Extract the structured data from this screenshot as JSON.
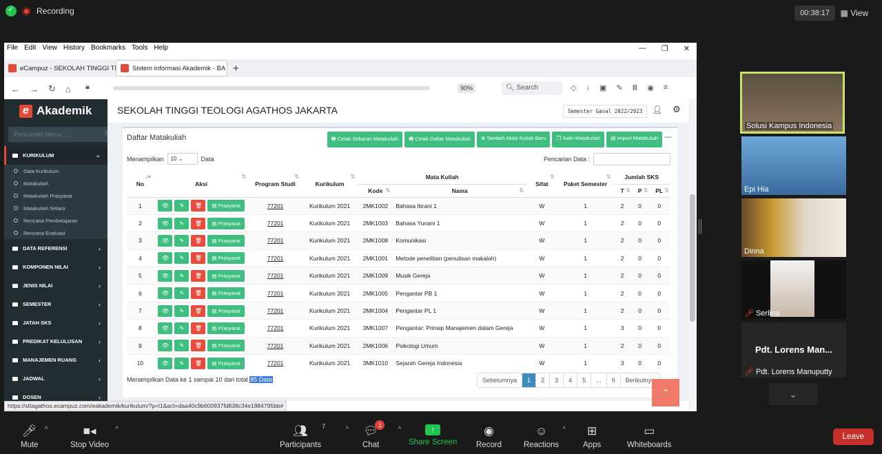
{
  "zoom": {
    "recording": "Recording",
    "clock": "00:38:17",
    "view": "View",
    "toolbar": {
      "mute": "Mute",
      "stop_video": "Stop Video",
      "participants": "Participants",
      "participants_count": "7",
      "chat": "Chat",
      "chat_badge": "1",
      "share": "Share Screen",
      "record": "Record",
      "reactions": "Reactions",
      "apps": "Apps",
      "whiteboards": "Whiteboards",
      "leave": "Leave"
    },
    "tiles": [
      "Solusi Kampus Indonesia",
      "Epi Hia",
      "Dinna",
      "Serlina",
      "Pdt. Lorens Manuputty"
    ],
    "tile5_name": "Pdt. Lorens Man..."
  },
  "browser": {
    "menu": [
      "File",
      "Edit",
      "View",
      "History",
      "Bookmarks",
      "Tools",
      "Help"
    ],
    "tabs": [
      "eCampuz - SEKOLAH TINGGI TE",
      "Sistem informasi Akademik - BA"
    ],
    "zoom": "90%",
    "search": "Search",
    "status_url": "https://sttagathos.ecampuz.com/eakademik/kurikulum/?p=l1&act=daa40c9b600937fd838c34e1884795bb#"
  },
  "app": {
    "logo": "Akademik",
    "menu_search_placeholder": "Pencarian Menu ...",
    "school": "SEKOLAH TINGGI TEOLOGI AGATHOS JAKARTA",
    "semester": "Semester Gasal 2022/2023",
    "menu": {
      "kurikulum": "KURIKULUM",
      "sub": [
        "Data Kurikulum",
        "Matakuliah",
        "Matakuliah Prasyarat",
        "Matakuliah Setara",
        "Rencana Pembelajaran",
        "Rencana Evaluasi"
      ],
      "others": [
        "DATA REFERENSI",
        "KOMPONEN NILAI",
        "JENIS NILAI",
        "SEMESTER",
        "JATAH SKS",
        "PREDIKAT KELULUSAN",
        "MANAJEMEN RUANG",
        "JADWAL",
        "DOSEN"
      ]
    },
    "box_title": "Daftar Matakuliah",
    "buttons": [
      "Cetak Sebaran Matakuliah",
      "Cetak Daftar Matakuliah",
      "Tambah Mata Kuliah Baru",
      "Salin Matakuliah",
      "Import Matakuliah"
    ],
    "show_label": "Menampilkan",
    "show_value": "10",
    "show_suffix": "Data",
    "search_label": "Pencarian Data :",
    "headers": {
      "no": "No",
      "aksi": "Aksi",
      "prodi": "Program Studi",
      "kurikulum": "Kurikulum",
      "mk": "Mata Kuliah",
      "kode": "Kode",
      "nama": "Nama",
      "sifat": "Sifat",
      "paket": "Paket Semester",
      "sks": "Jumlah SKS",
      "t": "T",
      "p": "P",
      "pl": "PL"
    },
    "prasyarat": "Prasyarat",
    "rows": [
      {
        "no": "1",
        "prodi": "77201",
        "kur": "Kurikulum 2021",
        "kode": "2MK1002",
        "nama": "Bahasa Ibrani 1",
        "sifat": "W",
        "paket": "1",
        "t": "2",
        "p": "0",
        "pl": "0"
      },
      {
        "no": "2",
        "prodi": "77201",
        "kur": "Kurikulum 2021",
        "kode": "2MK1003",
        "nama": "Bahasa Yunani 1",
        "sifat": "W",
        "paket": "1",
        "t": "2",
        "p": "0",
        "pl": "0"
      },
      {
        "no": "3",
        "prodi": "77201",
        "kur": "Kurikulum 2021",
        "kode": "2MK1008",
        "nama": "Komunikasi",
        "sifat": "W",
        "paket": "1",
        "t": "2",
        "p": "0",
        "pl": "0"
      },
      {
        "no": "4",
        "prodi": "77201",
        "kur": "Kurikulum 2021",
        "kode": "2MK1001",
        "nama": "Metode penelitian (penulisan makalah)",
        "sifat": "W",
        "paket": "1",
        "t": "2",
        "p": "0",
        "pl": "0"
      },
      {
        "no": "5",
        "prodi": "77201",
        "kur": "Kurikulum 2021",
        "kode": "2MK1009",
        "nama": "Musik Gereja",
        "sifat": "W",
        "paket": "1",
        "t": "2",
        "p": "0",
        "pl": "0"
      },
      {
        "no": "6",
        "prodi": "77201",
        "kur": "Kurikulum 2021",
        "kode": "2MK1005",
        "nama": "Pengantar PB 1",
        "sifat": "W",
        "paket": "1",
        "t": "2",
        "p": "0",
        "pl": "0"
      },
      {
        "no": "7",
        "prodi": "77201",
        "kur": "Kurikulum 2021",
        "kode": "2MK1004",
        "nama": "Pengantar PL 1",
        "sifat": "W",
        "paket": "1",
        "t": "2",
        "p": "0",
        "pl": "0"
      },
      {
        "no": "8",
        "prodi": "77201",
        "kur": "Kurikulum 2021",
        "kode": "3MK1007",
        "nama": "Pengantar: Prinsip Manajemen dalam Gereja",
        "sifat": "W",
        "paket": "1",
        "t": "3",
        "p": "0",
        "pl": "0"
      },
      {
        "no": "9",
        "prodi": "77201",
        "kur": "Kurikulum 2021",
        "kode": "2MK1006",
        "nama": "Psikologi Umum",
        "sifat": "W",
        "paket": "1",
        "t": "2",
        "p": "0",
        "pl": "0"
      },
      {
        "no": "10",
        "prodi": "77201",
        "kur": "Kurikulum 2021",
        "kode": "3MK1010",
        "nama": "Sejarah Gereja Indonesia",
        "sifat": "W",
        "paket": "1",
        "t": "3",
        "p": "0",
        "pl": "0"
      }
    ],
    "info_prefix": "Menampilkan Data ke 1 sampai 10 dari total ",
    "info_total": "85 Data",
    "pager": [
      "Sebelumnya",
      "1",
      "2",
      "3",
      "4",
      "5",
      "...",
      "9",
      "Berikutnya"
    ]
  }
}
